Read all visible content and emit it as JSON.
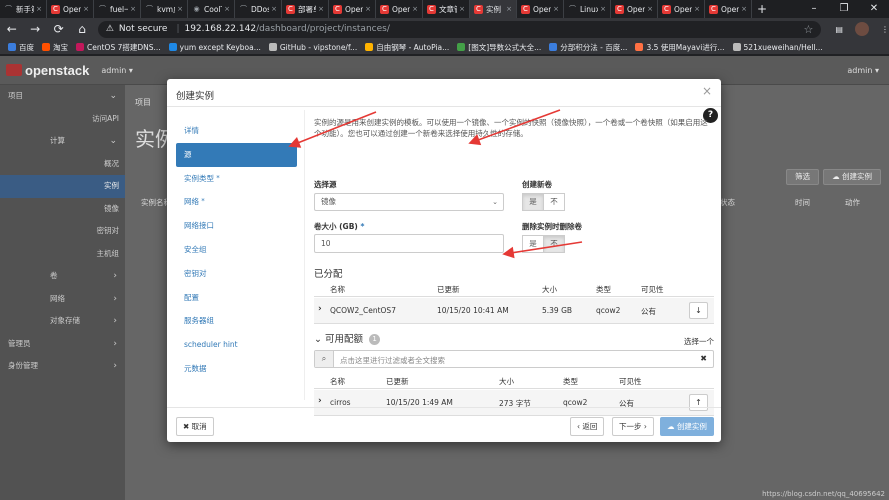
{
  "browser": {
    "tabs": [
      {
        "title": "新手第一",
        "icon": "wp"
      },
      {
        "title": "OpenSta",
        "icon": "os"
      },
      {
        "title": "fuel一键",
        "icon": "wp"
      },
      {
        "title": "kvm虚拟",
        "icon": "wp"
      },
      {
        "title": "CoolTon",
        "icon": "gh"
      },
      {
        "title": "DDos巨",
        "icon": "w"
      },
      {
        "title": "部署单",
        "icon": "os"
      },
      {
        "title": "OpenSta",
        "icon": "os"
      },
      {
        "title": "OpenSta",
        "icon": "os"
      },
      {
        "title": "文章管理",
        "icon": "os"
      },
      {
        "title": "实例",
        "icon": "os",
        "active": true
      },
      {
        "title": "OpenSta",
        "icon": "os"
      },
      {
        "title": "Linux系",
        "icon": "wp"
      },
      {
        "title": "OpenSta",
        "icon": "os"
      },
      {
        "title": "OpenSta",
        "icon": "os"
      },
      {
        "title": "OpenSta",
        "icon": "os"
      }
    ],
    "not_secure": "Not secure",
    "url_host": "192.168.22.142",
    "url_path": "/dashboard/project/instances/",
    "bookmarks": [
      {
        "label": "百度",
        "color": "#3b7ddd"
      },
      {
        "label": "淘宝",
        "color": "#ff5000"
      },
      {
        "label": "CentOS 7搭建DNS...",
        "color": "#c2185b"
      },
      {
        "label": "yum except Keyboa...",
        "color": "#1e88e5"
      },
      {
        "label": "GitHub - vipstone/f...",
        "color": "#bbbbbb"
      },
      {
        "label": "自由钢琴 - AutoPia...",
        "color": "#ffb300"
      },
      {
        "label": "[图文]导数公式大全...",
        "color": "#43a047"
      },
      {
        "label": "分部积分法 - 百度...",
        "color": "#3b7ddd"
      },
      {
        "label": "3.5 使用Mayavi进行...",
        "color": "#ff7043"
      },
      {
        "label": "521xueweihan/Hell...",
        "color": "#bbbbbb"
      }
    ]
  },
  "openstack": {
    "logo": "openstack",
    "project": "admin ▾",
    "user": "admin ▾",
    "breadcrumb": "项目",
    "heading": "实例",
    "filter_button": "筛选",
    "create_button": "创建实例",
    "table_cols": [
      "实例名称",
      "状态",
      "时间",
      "动作"
    ],
    "sidebar": [
      {
        "label": "项目",
        "level": 1,
        "caret": "⌄"
      },
      {
        "label": "访问API",
        "level": 3
      },
      {
        "label": "计算",
        "level": 2,
        "caret": "⌄"
      },
      {
        "label": "概况",
        "level": 3
      },
      {
        "label": "实例",
        "level": 3,
        "active": true
      },
      {
        "label": "镜像",
        "level": 3
      },
      {
        "label": "密钥对",
        "level": 3
      },
      {
        "label": "主机组",
        "level": 3
      },
      {
        "label": "卷",
        "level": 2,
        "caret": "›"
      },
      {
        "label": "网络",
        "level": 2,
        "caret": "›"
      },
      {
        "label": "对象存储",
        "level": 2,
        "caret": "›"
      },
      {
        "label": "管理员",
        "level": 1,
        "caret": "›"
      },
      {
        "label": "身份管理",
        "level": 1,
        "caret": "›"
      }
    ]
  },
  "modal": {
    "title": "创建实例",
    "nav": [
      {
        "label": "详情"
      },
      {
        "label": "源",
        "active": true
      },
      {
        "label": "实例类型",
        "required": true
      },
      {
        "label": "网络",
        "required": true
      },
      {
        "label": "网络接口"
      },
      {
        "label": "安全组"
      },
      {
        "label": "密钥对"
      },
      {
        "label": "配置"
      },
      {
        "label": "服务器组"
      },
      {
        "label": "scheduler hint"
      },
      {
        "label": "元数据"
      }
    ],
    "intro": "实例的源是用来创建实例的模板。可以使用一个镜像、一个实例的快照（镜像快照），一个卷或一个卷快照（如果启用这个功能）。您也可以通过创建一个新卷来选择使用持久性的存储。",
    "select_source_label": "选择源",
    "select_source_value": "镜像",
    "create_volume_label": "创建新卷",
    "create_volume_yes": "是",
    "create_volume_no": "不",
    "volume_size_label": "卷大小 (GB)",
    "volume_size_value": "10",
    "delete_on_term_label": "删除实例时删除卷",
    "delete_yes": "是",
    "delete_no": "不",
    "allocated_title": "已分配",
    "allocated_cols": [
      "名称",
      "已更新",
      "大小",
      "类型",
      "可见性"
    ],
    "allocated_rows": [
      {
        "name": "QCOW2_CentOS7",
        "updated": "10/15/20 10:41 AM",
        "size": "5.39 GB",
        "type": "qcow2",
        "visibility": "公有"
      }
    ],
    "available_title": "可用配额",
    "available_count": "1",
    "pick_one": "选择一个",
    "search_placeholder": "点击这里进行过滤或者全文搜索",
    "available_cols": [
      "名称",
      "已更新",
      "大小",
      "类型",
      "可见性"
    ],
    "available_rows": [
      {
        "name": "cirros",
        "updated": "10/15/20 1:49 AM",
        "size": "273 字节",
        "type": "qcow2",
        "visibility": "公有"
      }
    ],
    "cancel": "✖ 取消",
    "back": "‹ 返回",
    "next": "下一步 ›",
    "launch": "创建实例"
  },
  "watermark": "https://blog.csdn.net/qq_40695642",
  "colors": {
    "accent": "#337ab7",
    "annotation": "#e53935"
  }
}
